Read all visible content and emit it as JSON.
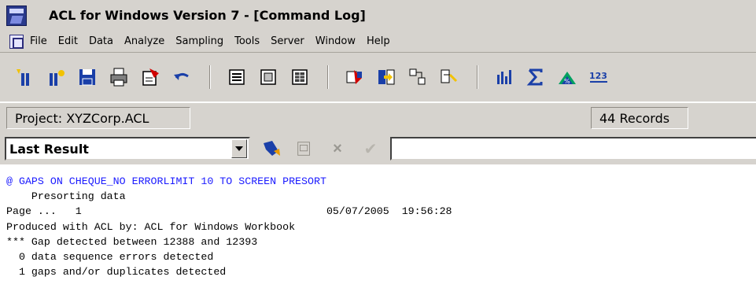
{
  "window": {
    "title": "ACL for Windows Version 7 - [Command Log]"
  },
  "menu": {
    "items": [
      "File",
      "Edit",
      "Data",
      "Analyze",
      "Sampling",
      "Tools",
      "Server",
      "Window",
      "Help"
    ]
  },
  "toolbar": {
    "icons": [
      "new-project-icon",
      "open-project-icon",
      "save-icon",
      "print-icon",
      "note-icon",
      "undo-icon",
      "view1-icon",
      "view2-icon",
      "table-icon",
      "filter-icon",
      "extract-icon",
      "relate-icon",
      "join-icon",
      "report-icon",
      "sum-icon",
      "graph-icon",
      "statistics-icon"
    ]
  },
  "status": {
    "project": "Project: XYZCorp.ACL",
    "records": "44 Records"
  },
  "filter": {
    "selected": "Last Result"
  },
  "log": {
    "lines": [
      "@ GAPS ON CHEQUE_NO ERRORLIMIT 10 TO SCREEN PRESORT",
      "    Presorting data",
      "Page ...   1                                       05/07/2005  19:56:28",
      "Produced with ACL by: ACL for Windows Workbook",
      "*** Gap detected between 12388 and 12393",
      "  0 data sequence errors detected",
      "  1 gaps and/or duplicates detected"
    ]
  }
}
